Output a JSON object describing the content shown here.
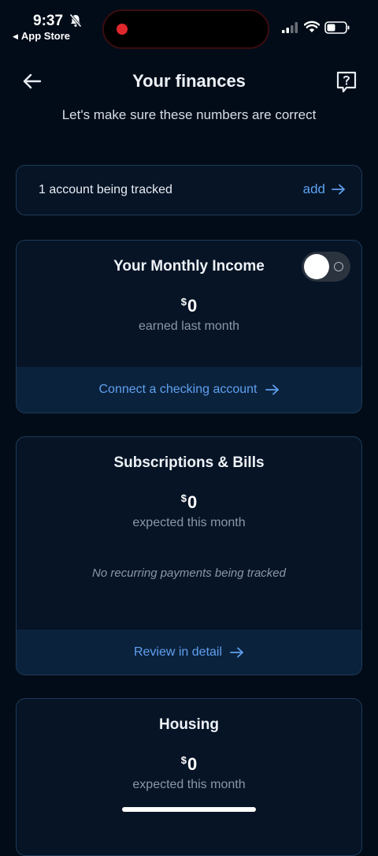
{
  "status_bar": {
    "time": "9:37",
    "back_app": "App Store"
  },
  "nav": {
    "title": "Your finances"
  },
  "subtitle": "Let's make sure these numbers are correct",
  "accounts": {
    "label": "1 account being tracked",
    "add_label": "add"
  },
  "income": {
    "title": "Your Monthly Income",
    "currency": "$",
    "amount": "0",
    "caption": "earned last month",
    "toggle_on": false,
    "link": "Connect a checking account"
  },
  "subscriptions": {
    "title": "Subscriptions & Bills",
    "currency": "$",
    "amount": "0",
    "caption": "expected this month",
    "empty": "No recurring payments being tracked",
    "link": "Review in detail"
  },
  "housing": {
    "title": "Housing",
    "currency": "$",
    "amount": "0",
    "caption": "expected this month"
  },
  "colors": {
    "accent": "#5fa0ee",
    "background": "#020c18",
    "card": "#061426",
    "card_border": "#1e3a57",
    "recording": "#e0282c"
  }
}
